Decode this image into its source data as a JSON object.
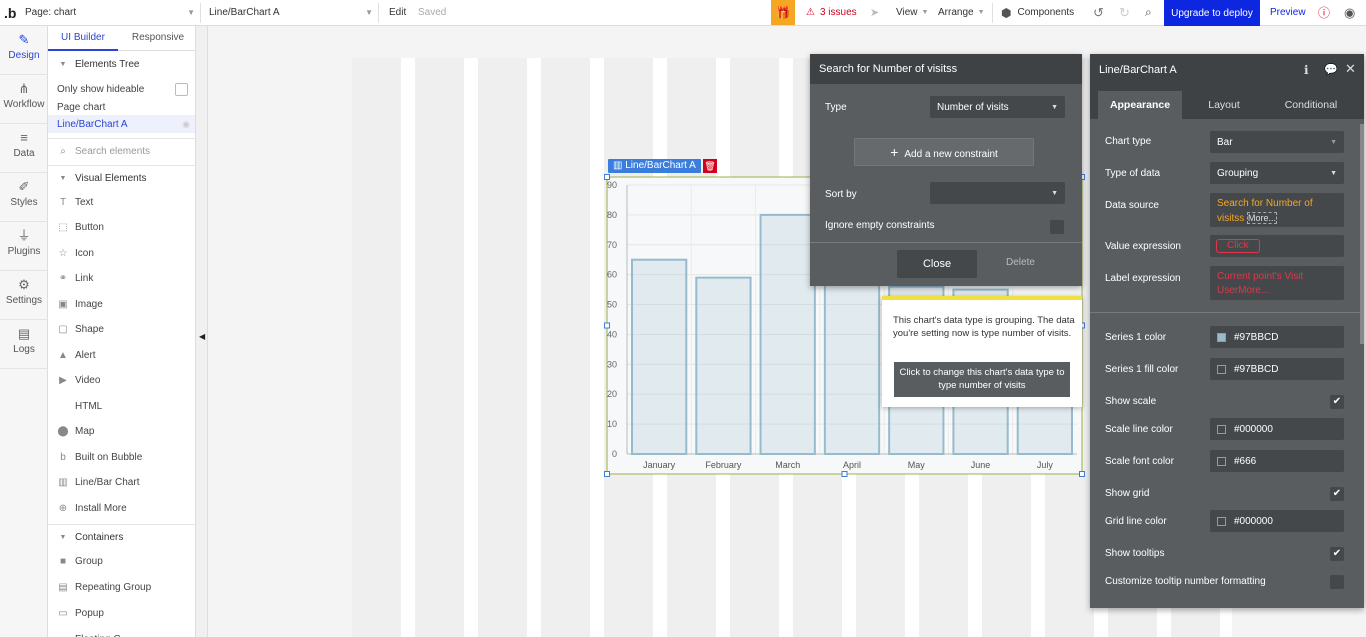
{
  "topbar": {
    "logo": ".b",
    "page": "Page: chart",
    "element": "Line/BarChart A",
    "edit": "Edit",
    "saved": "Saved",
    "issues": "3 issues",
    "view": "View",
    "arrange": "Arrange",
    "components": "Components",
    "upgrade": "Upgrade to deploy",
    "preview": "Preview"
  },
  "iconbar": [
    {
      "label": "Design",
      "icon": "design-icon"
    },
    {
      "label": "Workflow",
      "icon": "workflow-icon"
    },
    {
      "label": "Data",
      "icon": "data-icon"
    },
    {
      "label": "Styles",
      "icon": "brush-icon"
    },
    {
      "label": "Plugins",
      "icon": "plug-icon"
    },
    {
      "label": "Settings",
      "icon": "gear-icon"
    },
    {
      "label": "Logs",
      "icon": "logs-icon"
    }
  ],
  "sidebar": {
    "tabs": [
      "UI Builder",
      "Responsive"
    ],
    "elements_tree": "Elements Tree",
    "only_hideable": "Only show hideable",
    "tree": [
      "Page chart",
      "Line/BarChart A"
    ],
    "search_placeholder": "Search elements",
    "visual_header": "Visual Elements",
    "visual": [
      "Text",
      "Button",
      "Icon",
      "Link",
      "Image",
      "Shape",
      "Alert",
      "Video",
      "HTML",
      "Map",
      "Built on Bubble",
      "Line/Bar Chart",
      "Install More"
    ],
    "containers_header": "Containers",
    "containers": [
      "Group",
      "Repeating Group",
      "Popup",
      "Floating G..."
    ]
  },
  "chart_tag": "Line/BarChart A",
  "chart_data": {
    "type": "bar",
    "categories": [
      "January",
      "February",
      "March",
      "April",
      "May",
      "June",
      "July"
    ],
    "series": [
      {
        "values": [
          65,
          59,
          80,
          81,
          56,
          55,
          40
        ]
      }
    ],
    "ylim": [
      0,
      90
    ],
    "yticks": [
      0,
      10,
      20,
      30,
      40,
      50,
      60,
      70,
      80,
      90
    ],
    "grid": true,
    "color": "#97BBCD"
  },
  "search_panel": {
    "title": "Search for Number of visitss",
    "type_label": "Type",
    "type_value": "Number of visits",
    "add_constraint": "Add a new constraint",
    "sort_label": "Sort by",
    "ignore_label": "Ignore empty constraints",
    "close": "Close",
    "delete": "Delete"
  },
  "tooltip": {
    "text": "This chart's data type is grouping. The data you're setting now is type number of visits.",
    "button": "Click to change this chart's data type to type number of visits"
  },
  "props": {
    "title": "Line/BarChart A",
    "tabs": [
      "Appearance",
      "Layout",
      "Conditional"
    ],
    "chart_type_label": "Chart type",
    "chart_type": "Bar",
    "type_of_data_label": "Type of data",
    "type_of_data": "Grouping",
    "data_source_label": "Data source",
    "data_source": "Search for Number of visitss",
    "more": "More...",
    "value_expr_label": "Value expression",
    "value_expr": "Click",
    "label_expr_label": "Label expression",
    "label_expr": "Current point's Visit User",
    "series1_color_label": "Series 1 color",
    "series1_color": "#97BBCD",
    "series1_fill_label": "Series 1 fill color",
    "series1_fill": "#97BBCD",
    "show_scale": "Show scale",
    "scale_line_label": "Scale line color",
    "scale_line": "#000000",
    "scale_font_label": "Scale font color",
    "scale_font": "#666",
    "show_grid": "Show grid",
    "grid_line_label": "Grid line color",
    "grid_line": "#000000",
    "show_tooltips": "Show tooltips",
    "customize": "Customize tooltip number formatting"
  },
  "colors": {
    "accent": "#3b5fd9",
    "upgrade": "#0d26e0",
    "dark_panel": "#5a5d60",
    "error": "#d0021b"
  }
}
